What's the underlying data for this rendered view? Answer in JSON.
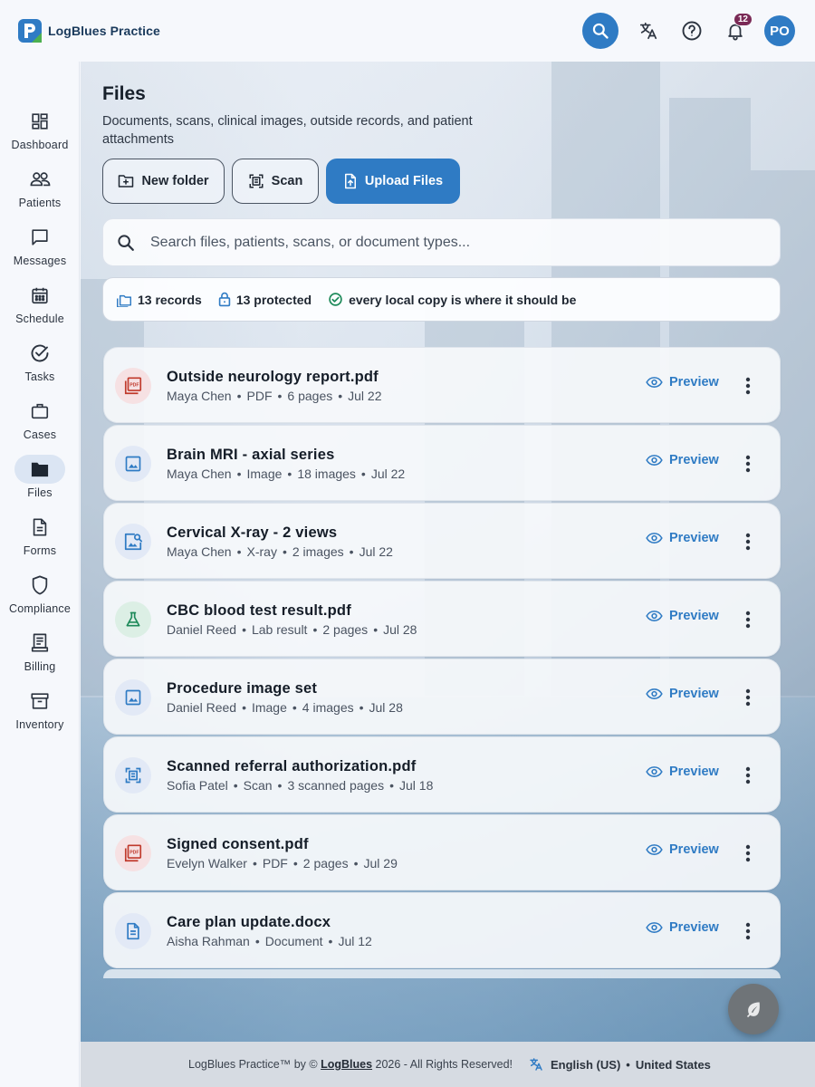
{
  "app": {
    "name": "LogBlues Practice",
    "notification_count": "12",
    "user_initials": "PO"
  },
  "colors": {
    "primary": "#2f7bc4",
    "badge": "#7a2a56",
    "pdf": "#c0392b",
    "lab": "#1e8a5a"
  },
  "sidebar": {
    "items": [
      {
        "label": "Dashboard",
        "icon": "dashboard-icon"
      },
      {
        "label": "Patients",
        "icon": "patients-icon"
      },
      {
        "label": "Messages",
        "icon": "messages-icon"
      },
      {
        "label": "Schedule",
        "icon": "schedule-icon"
      },
      {
        "label": "Tasks",
        "icon": "tasks-icon"
      },
      {
        "label": "Cases",
        "icon": "cases-icon"
      },
      {
        "label": "Files",
        "icon": "folder-icon",
        "active": true
      },
      {
        "label": "Forms",
        "icon": "forms-icon"
      },
      {
        "label": "Compliance",
        "icon": "shield-icon"
      },
      {
        "label": "Billing",
        "icon": "billing-icon"
      },
      {
        "label": "Inventory",
        "icon": "inventory-icon"
      }
    ]
  },
  "page": {
    "title": "Files",
    "subtitle": "Documents, scans, clinical images, outside records, and patient attachments",
    "new_folder_label": "New folder",
    "scan_label": "Scan",
    "upload_label": "Upload Files"
  },
  "search": {
    "placeholder": "Search files, patients, scans, or document types..."
  },
  "stats": {
    "records": "13 records",
    "protected": "13 protected",
    "sync": "every local copy is where it should be"
  },
  "files": [
    {
      "name": "Outside neurology report.pdf",
      "patient": "Maya Chen",
      "type": "PDF",
      "count": "6 pages",
      "date": "Jul 22",
      "icon": "pdf-icon"
    },
    {
      "name": "Brain MRI - axial series",
      "patient": "Maya Chen",
      "type": "Image",
      "count": "18 images",
      "date": "Jul 22",
      "icon": "image-icon"
    },
    {
      "name": "Cervical X-ray - 2 views",
      "patient": "Maya Chen",
      "type": "X-ray",
      "count": "2 images",
      "date": "Jul 22",
      "icon": "xray-icon"
    },
    {
      "name": "CBC blood test result.pdf",
      "patient": "Daniel Reed",
      "type": "Lab result",
      "count": "2 pages",
      "date": "Jul 28",
      "icon": "flask-icon"
    },
    {
      "name": "Procedure image set",
      "patient": "Daniel Reed",
      "type": "Image",
      "count": "4 images",
      "date": "Jul 28",
      "icon": "image-icon"
    },
    {
      "name": "Scanned referral authorization.pdf",
      "patient": "Sofia Patel",
      "type": "Scan",
      "count": "3 scanned pages",
      "date": "Jul 18",
      "icon": "scan-icon"
    },
    {
      "name": "Signed consent.pdf",
      "patient": "Evelyn Walker",
      "type": "PDF",
      "count": "2 pages",
      "date": "Jul 29",
      "icon": "pdf-icon"
    },
    {
      "name": "Care plan update.docx",
      "patient": "Aisha Rahman",
      "type": "Document",
      "date": "Jul 12",
      "icon": "document-icon"
    }
  ],
  "row_actions": {
    "preview_label": "Preview"
  },
  "footer": {
    "copyright_prefix": "LogBlues Practice™ by ©",
    "brand": "LogBlues",
    "copyright_suffix": "2026 - All Rights Reserved!",
    "language": "English (US)",
    "region": "United States"
  }
}
